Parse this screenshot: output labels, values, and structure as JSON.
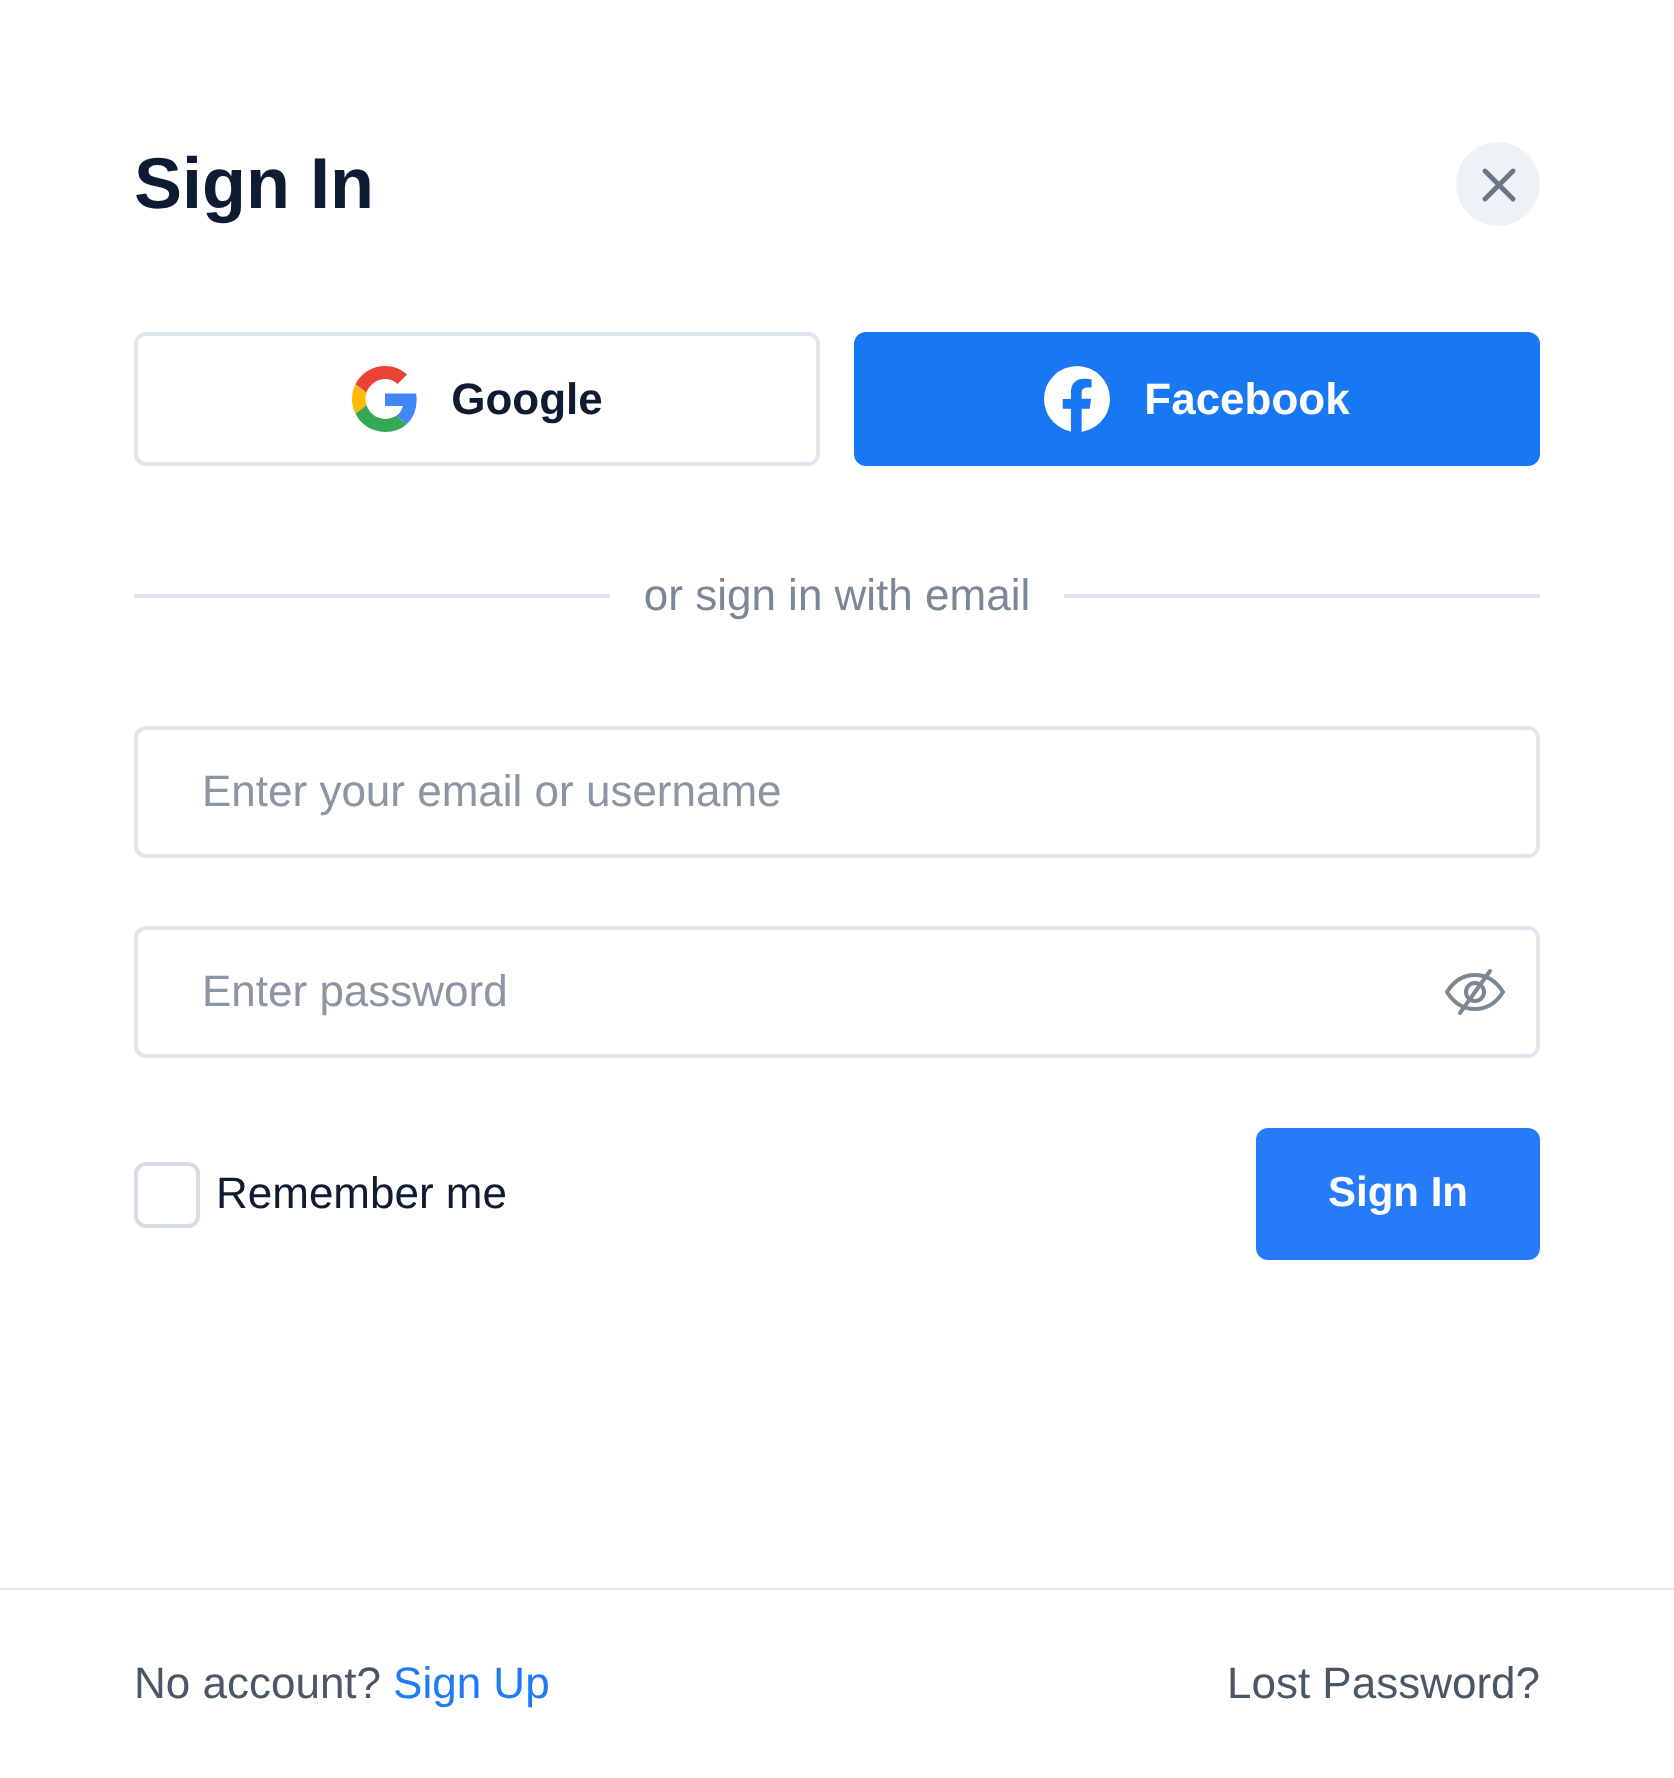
{
  "dialog": {
    "title": "Sign In"
  },
  "social_buttons": [
    {
      "kind": "google",
      "label": "Google"
    },
    {
      "kind": "facebook",
      "label": "Facebook"
    }
  ],
  "separator": {
    "label": "or sign in with email"
  },
  "fields": [
    {
      "kind": "text",
      "placeholder": "Enter your email or username"
    },
    {
      "kind": "password",
      "placeholder": "Enter password",
      "revealed": false
    }
  ],
  "remember_me": {
    "label": "Remember me",
    "checked": false
  },
  "submit_button": {
    "label": "Sign In"
  },
  "footer": {
    "prompt": "No account?",
    "signup_link": "Sign Up",
    "lost_password_link": "Lost Password?"
  }
}
